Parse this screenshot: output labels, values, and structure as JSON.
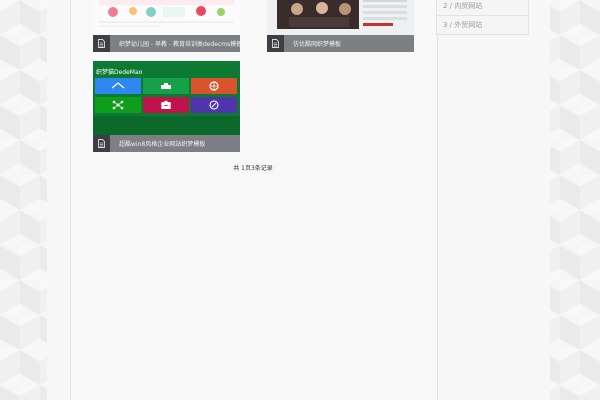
{
  "cards": [
    {
      "title": "织梦幼儿园 - 早教 - 教育培训类dedecms模板",
      "thumb_colors": [
        "#ffffff",
        "#e84a5f",
        "#f3b6c3",
        "#7fd1c7"
      ]
    },
    {
      "title": "仿优酷网织梦模板",
      "thumb_colors": [
        "#2b2b2b",
        "#c9302c",
        "#cfd6dd"
      ]
    },
    {
      "title": "超酷win8风格企业网站织梦模板",
      "metro_title": "织梦猫DedeMao",
      "tile_colors": [
        "#2d89ef",
        "#16a04a",
        "#d9532c",
        "#0f9d1c",
        "#c1134b",
        "#5133ab"
      ]
    }
  ],
  "pagination": {
    "text": "共 1页3条记录"
  },
  "sidebar": {
    "items": [
      {
        "label": "2 / 内贸网站"
      },
      {
        "label": "3 / 外贸网站"
      }
    ]
  },
  "colors": {
    "caption_bg": "#7c7f84",
    "icon_bg": "#3c3f44"
  }
}
